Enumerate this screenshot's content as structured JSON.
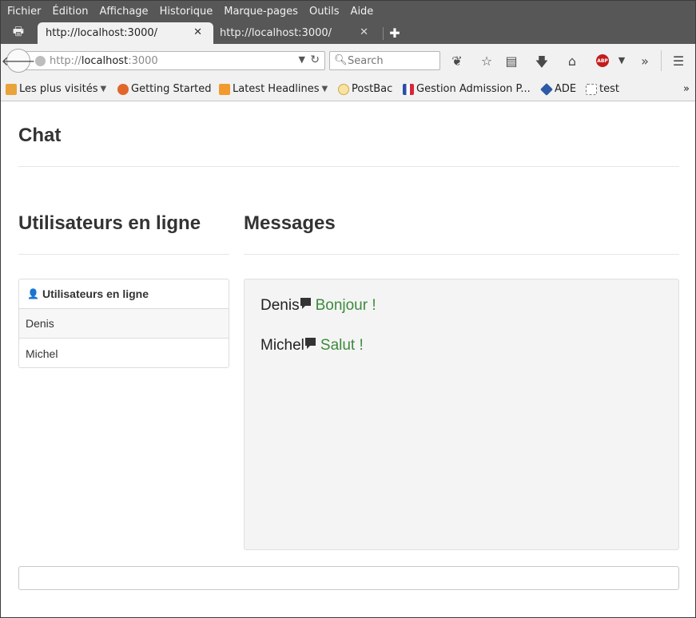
{
  "menubar": {
    "items": [
      "Fichier",
      "Édition",
      "Affichage",
      "Historique",
      "Marque-pages",
      "Outils",
      "Aide"
    ]
  },
  "tabs": [
    {
      "label": "http://localhost:3000/",
      "active": true
    },
    {
      "label": "http://localhost:3000/",
      "active": false
    }
  ],
  "navbar": {
    "url_scheme": "http://",
    "url_host": "localhost",
    "url_port": ":3000",
    "search_placeholder": "Search"
  },
  "bookmarks": [
    {
      "label": "Les plus visités",
      "icon": "folder-icon",
      "dropdown": true
    },
    {
      "label": "Getting Started",
      "icon": "firefox-icon",
      "dropdown": false
    },
    {
      "label": "Latest Headlines",
      "icon": "rss-icon",
      "dropdown": true
    },
    {
      "label": "PostBac",
      "icon": "postbac-icon",
      "dropdown": false
    },
    {
      "label": "Gestion Admission P...",
      "icon": "flag-fr-icon",
      "dropdown": false
    },
    {
      "label": "ADE",
      "icon": "ade-icon",
      "dropdown": false
    },
    {
      "label": "test",
      "icon": "page-icon",
      "dropdown": false
    }
  ],
  "page": {
    "title": "Chat",
    "users_section_title": "Utilisateurs en ligne",
    "messages_section_title": "Messages",
    "users_panel_heading": "Utilisateurs en ligne",
    "users": [
      "Denis",
      "Michel"
    ],
    "messages": [
      {
        "author": "Denis",
        "text": "Bonjour !"
      },
      {
        "author": "Michel",
        "text": "Salut !"
      }
    ],
    "input_value": ""
  },
  "colors": {
    "message_text": "#3c8a3c",
    "chrome_dark": "#575757",
    "toolbar_light": "#f1f1f1"
  }
}
